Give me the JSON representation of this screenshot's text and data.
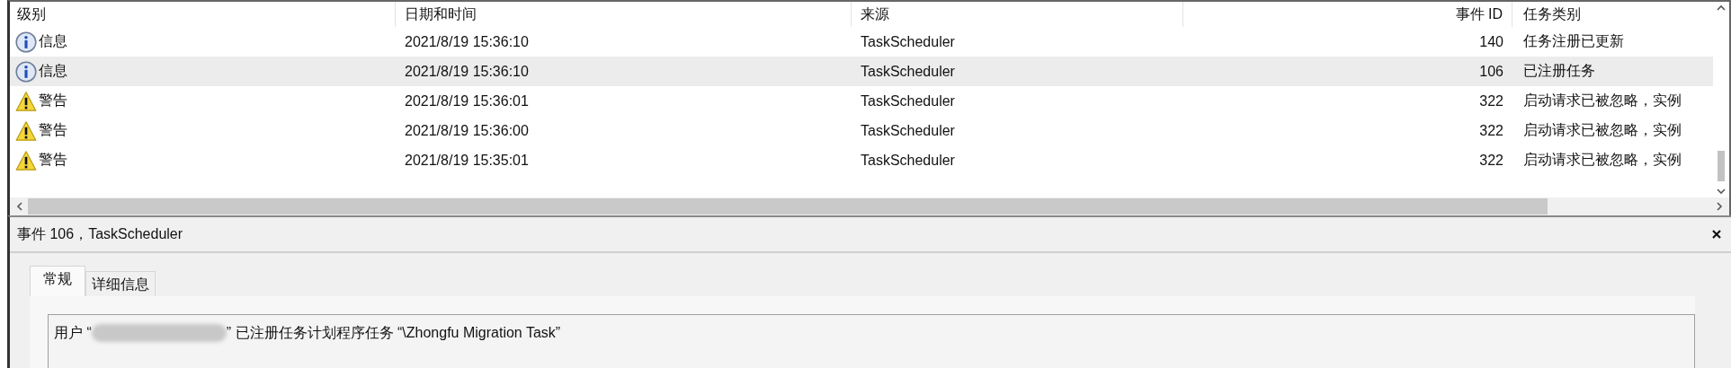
{
  "event_list": {
    "columns": [
      "级别",
      "日期和时间",
      "来源",
      "事件 ID",
      "任务类别"
    ],
    "rows": [
      {
        "kind": "info",
        "level": "信息",
        "datetime": "2021/8/19 15:36:10",
        "source": "TaskScheduler",
        "event_id": "140",
        "category": "任务注册已更新",
        "selected": false
      },
      {
        "kind": "info",
        "level": "信息",
        "datetime": "2021/8/19 15:36:10",
        "source": "TaskScheduler",
        "event_id": "106",
        "category": "已注册任务",
        "selected": true
      },
      {
        "kind": "warning",
        "level": "警告",
        "datetime": "2021/8/19 15:36:01",
        "source": "TaskScheduler",
        "event_id": "322",
        "category": "启动请求已被忽略，实例",
        "selected": false
      },
      {
        "kind": "warning",
        "level": "警告",
        "datetime": "2021/8/19 15:36:00",
        "source": "TaskScheduler",
        "event_id": "322",
        "category": "启动请求已被忽略，实例",
        "selected": false
      },
      {
        "kind": "warning",
        "level": "警告",
        "datetime": "2021/8/19 15:35:01",
        "source": "TaskScheduler",
        "event_id": "322",
        "category": "启动请求已被忽略，实例",
        "selected": false
      }
    ]
  },
  "detail": {
    "title": "事件 106，TaskScheduler",
    "tabs": [
      {
        "label": "常规",
        "selected": true
      },
      {
        "label": "详细信息",
        "selected": false
      }
    ],
    "message": {
      "before": "用户 “",
      "after": "” 已注册任务计划程序任务 “\\Zhongfu Migration Task”"
    }
  }
}
